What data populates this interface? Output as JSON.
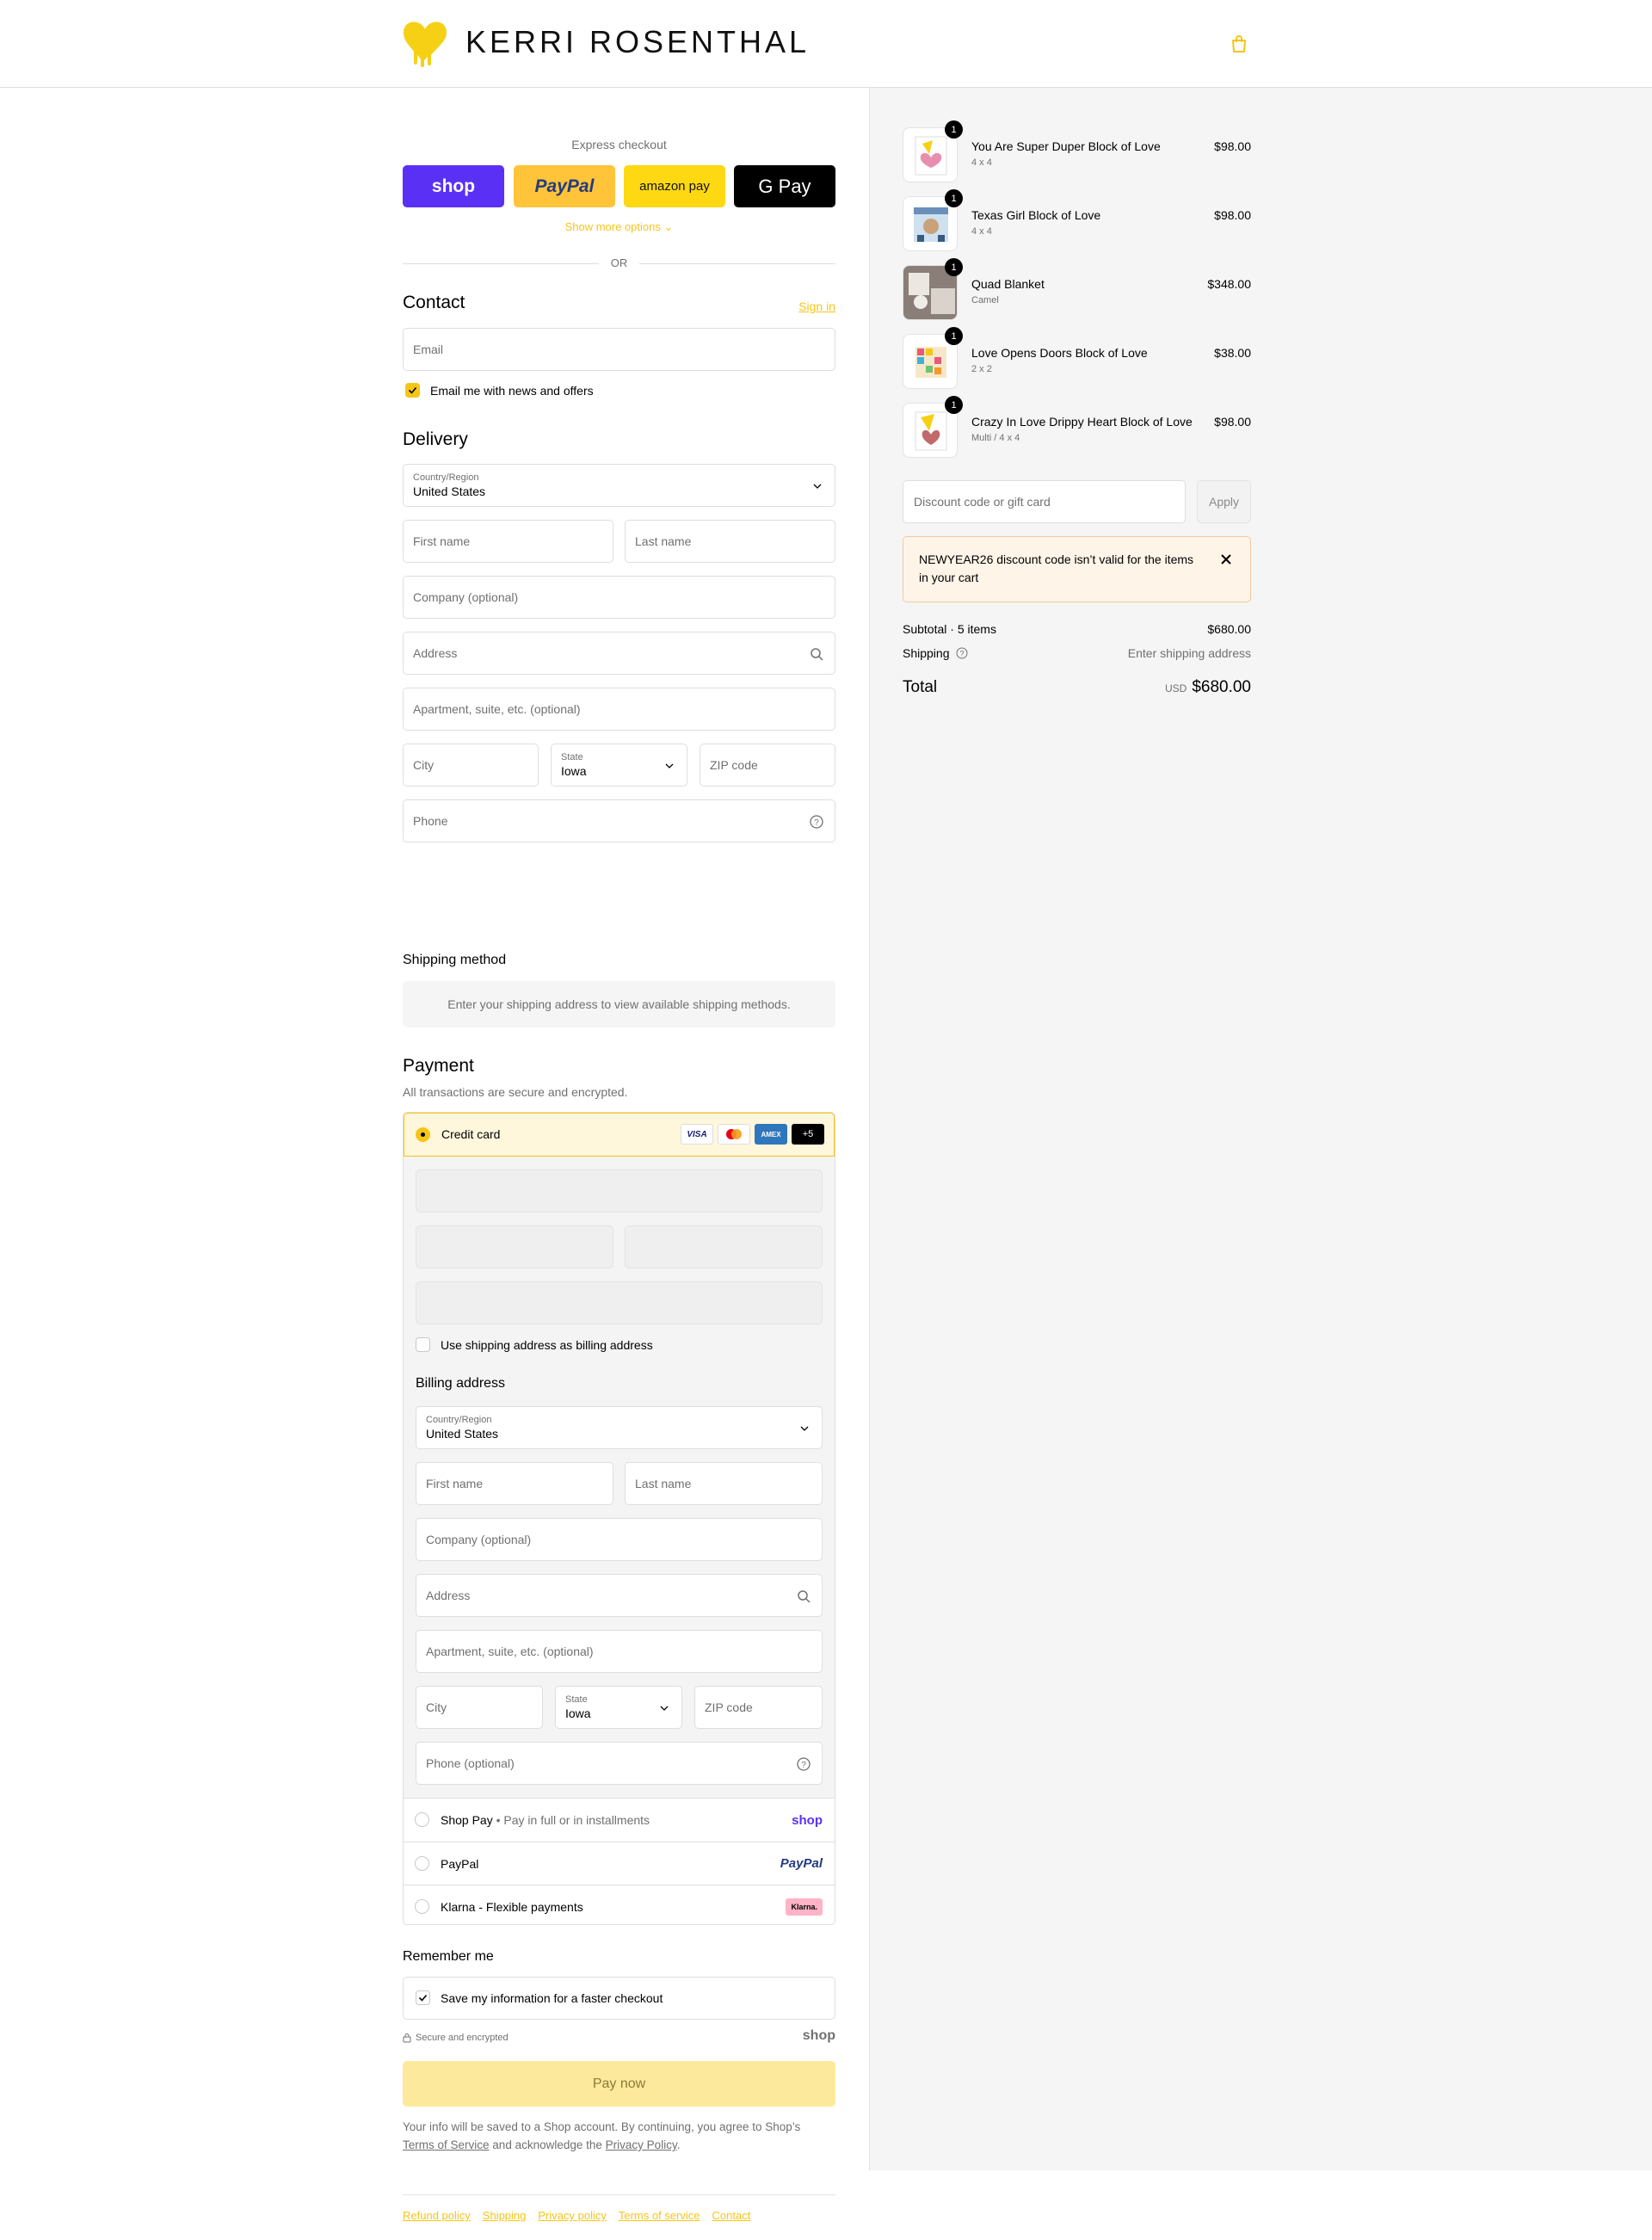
{
  "brand": {
    "name": "KERRI ROSENTHAL",
    "accent": "#f5c518"
  },
  "express": {
    "title": "Express checkout",
    "buttons": [
      "shop",
      "PayPal",
      "amazon pay",
      "G Pay"
    ],
    "more": "Show more options",
    "or": "OR"
  },
  "contact": {
    "title": "Contact",
    "signin": "Sign in",
    "email_placeholder": "Email",
    "news_label": "Email me with news and offers",
    "news_checked": true
  },
  "delivery": {
    "title": "Delivery",
    "country_label": "Country/Region",
    "country": "United States",
    "first_name": "First name",
    "last_name": "Last name",
    "company": "Company (optional)",
    "address": "Address",
    "apartment": "Apartment, suite, etc. (optional)",
    "city": "City",
    "state_label": "State",
    "state": "Iowa",
    "zip": "ZIP code",
    "phone": "Phone"
  },
  "shipping_method": {
    "title": "Shipping method",
    "message": "Enter your shipping address to view available shipping methods."
  },
  "payment": {
    "title": "Payment",
    "subtitle": "All transactions are secure and encrypted.",
    "credit_card": "Credit card",
    "cards": [
      "VISA",
      "MC",
      "AMEX",
      "+5"
    ],
    "use_shipping": "Use shipping address as billing address",
    "billing_title": "Billing address",
    "billing": {
      "country_label": "Country/Region",
      "country": "United States",
      "first_name": "First name",
      "last_name": "Last name",
      "company": "Company (optional)",
      "address": "Address",
      "apartment": "Apartment, suite, etc. (optional)",
      "city": "City",
      "state_label": "State",
      "state": "Iowa",
      "zip": "ZIP code",
      "phone": "Phone (optional)"
    },
    "shoppay": "Shop Pay",
    "shoppay_sub": "Pay in full or in installments",
    "shoppay_logo": "shop",
    "paypal": "PayPal",
    "paypal_logo": "PayPal",
    "klarna": "Klarna - Flexible payments",
    "klarna_logo": "Klarna."
  },
  "remember": {
    "title": "Remember me",
    "save_label": "Save my information for a faster checkout",
    "secure": "Secure and encrypted",
    "shop_logo": "shop"
  },
  "pay_now": "Pay now",
  "fine": {
    "text1": "Your info will be saved to a Shop account. By continuing, you agree to Shop’s",
    "tos": "Terms of Service",
    "text2": "and acknowledge the",
    "privacy": "Privacy Policy",
    "end": "."
  },
  "footer": [
    "Refund policy",
    "Shipping",
    "Privacy policy",
    "Terms of service",
    "Contact"
  ],
  "cart": {
    "items": [
      {
        "name": "You Are Super Duper Block of Love",
        "variant": "4 x 4",
        "price": "$98.00",
        "qty": "1"
      },
      {
        "name": "Texas Girl Block of Love",
        "variant": "4 x 4",
        "price": "$98.00",
        "qty": "1"
      },
      {
        "name": "Quad Blanket",
        "variant": "Camel",
        "price": "$348.00",
        "qty": "1"
      },
      {
        "name": "Love Opens Doors Block of Love",
        "variant": "2 x 2",
        "price": "$38.00",
        "qty": "1"
      },
      {
        "name": "Crazy In Love Drippy Heart Block of Love",
        "variant": "Multi / 4 x 4",
        "price": "$98.00",
        "qty": "1"
      }
    ],
    "discount_placeholder": "Discount code or gift card",
    "apply": "Apply",
    "alert": "NEWYEAR26 discount code isn’t valid for the items in your cart",
    "subtotal_label": "Subtotal · 5 items",
    "subtotal": "$680.00",
    "shipping_label": "Shipping",
    "shipping_value": "Enter shipping address",
    "total_label": "Total",
    "currency": "USD",
    "total": "$680.00"
  }
}
